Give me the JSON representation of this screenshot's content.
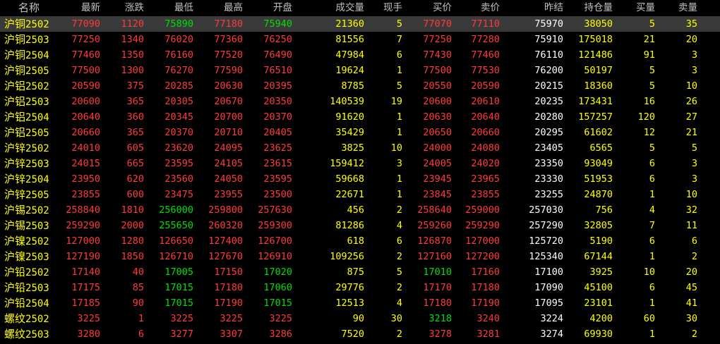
{
  "headers": [
    "名称",
    "最新",
    "涨跌",
    "最低",
    "最高",
    "开盘",
    "成交量",
    "现手",
    "买价",
    "卖价",
    "昨结",
    "持仓量",
    "买量",
    "卖量"
  ],
  "colors": {
    "up": "#ff3b3b",
    "down": "#00e000",
    "volume": "#ffff00",
    "neutral": "#ffffff",
    "name": "#ffff00",
    "header": "#c0c0c0",
    "selected_row_bg": "#3a3a3a"
  },
  "selected_row": 0,
  "rows": [
    {
      "prefix": "沪铜",
      "code": "2502",
      "values": [
        "77090",
        "1120",
        "75890",
        "77180",
        "75940",
        "21360",
        "5",
        "77070",
        "77110",
        "75970",
        "38050",
        "5",
        "35"
      ],
      "colors": [
        "r",
        "r",
        "g",
        "r",
        "g",
        "y",
        "y",
        "r",
        "r",
        "w",
        "y",
        "y",
        "y"
      ]
    },
    {
      "prefix": "沪铜",
      "code": "2503",
      "values": [
        "77250",
        "1340",
        "76020",
        "77360",
        "76250",
        "81556",
        "7",
        "77250",
        "77280",
        "75910",
        "175018",
        "21",
        "20"
      ],
      "colors": [
        "r",
        "r",
        "r",
        "r",
        "r",
        "y",
        "y",
        "r",
        "r",
        "w",
        "y",
        "y",
        "y"
      ]
    },
    {
      "prefix": "沪铜",
      "code": "2504",
      "values": [
        "77460",
        "1350",
        "76160",
        "77520",
        "76490",
        "47984",
        "6",
        "77430",
        "77460",
        "76110",
        "121486",
        "91",
        "3"
      ],
      "colors": [
        "r",
        "r",
        "r",
        "r",
        "r",
        "y",
        "y",
        "r",
        "r",
        "w",
        "y",
        "y",
        "y"
      ]
    },
    {
      "prefix": "沪铜",
      "code": "2505",
      "values": [
        "77500",
        "1300",
        "76270",
        "77590",
        "76510",
        "19624",
        "1",
        "77500",
        "77530",
        "76200",
        "50197",
        "5",
        "3"
      ],
      "colors": [
        "r",
        "r",
        "r",
        "r",
        "r",
        "y",
        "y",
        "r",
        "r",
        "w",
        "y",
        "y",
        "y"
      ]
    },
    {
      "prefix": "沪铝",
      "code": "2502",
      "values": [
        "20590",
        "375",
        "20285",
        "20630",
        "20395",
        "8785",
        "5",
        "20550",
        "20590",
        "20215",
        "18360",
        "5",
        "10"
      ],
      "colors": [
        "r",
        "r",
        "r",
        "r",
        "r",
        "y",
        "y",
        "r",
        "r",
        "w",
        "y",
        "y",
        "y"
      ]
    },
    {
      "prefix": "沪铝",
      "code": "2503",
      "values": [
        "20600",
        "365",
        "20305",
        "20670",
        "20350",
        "140539",
        "19",
        "20600",
        "20610",
        "20235",
        "173431",
        "16",
        "26"
      ],
      "colors": [
        "r",
        "r",
        "r",
        "r",
        "r",
        "y",
        "y",
        "r",
        "r",
        "w",
        "y",
        "y",
        "y"
      ]
    },
    {
      "prefix": "沪铝",
      "code": "2504",
      "values": [
        "20640",
        "360",
        "20345",
        "20700",
        "20370",
        "91620",
        "1",
        "20630",
        "20640",
        "20280",
        "157257",
        "120",
        "27"
      ],
      "colors": [
        "r",
        "r",
        "r",
        "r",
        "r",
        "y",
        "y",
        "r",
        "r",
        "w",
        "y",
        "y",
        "y"
      ]
    },
    {
      "prefix": "沪铝",
      "code": "2505",
      "values": [
        "20660",
        "365",
        "20370",
        "20710",
        "20405",
        "35429",
        "1",
        "20650",
        "20660",
        "20295",
        "61602",
        "12",
        "21"
      ],
      "colors": [
        "r",
        "r",
        "r",
        "r",
        "r",
        "y",
        "y",
        "r",
        "r",
        "w",
        "y",
        "y",
        "y"
      ]
    },
    {
      "prefix": "沪锌",
      "code": "2502",
      "values": [
        "24010",
        "605",
        "23620",
        "24095",
        "23625",
        "3825",
        "10",
        "24000",
        "24080",
        "23405",
        "6565",
        "5",
        "5"
      ],
      "colors": [
        "r",
        "r",
        "r",
        "r",
        "r",
        "y",
        "y",
        "r",
        "r",
        "w",
        "y",
        "y",
        "y"
      ]
    },
    {
      "prefix": "沪锌",
      "code": "2503",
      "values": [
        "24015",
        "665",
        "23595",
        "24105",
        "23615",
        "159412",
        "3",
        "24005",
        "24020",
        "23350",
        "93049",
        "6",
        "3"
      ],
      "colors": [
        "r",
        "r",
        "r",
        "r",
        "r",
        "y",
        "y",
        "r",
        "r",
        "w",
        "y",
        "y",
        "y"
      ]
    },
    {
      "prefix": "沪锌",
      "code": "2504",
      "values": [
        "23950",
        "620",
        "23560",
        "24050",
        "23595",
        "59668",
        "1",
        "23945",
        "23965",
        "23330",
        "51953",
        "6",
        "3"
      ],
      "colors": [
        "r",
        "r",
        "r",
        "r",
        "r",
        "y",
        "y",
        "r",
        "r",
        "w",
        "y",
        "y",
        "y"
      ]
    },
    {
      "prefix": "沪锌",
      "code": "2505",
      "values": [
        "23855",
        "600",
        "23475",
        "23955",
        "23500",
        "22671",
        "1",
        "23845",
        "23855",
        "23255",
        "24870",
        "1",
        "10"
      ],
      "colors": [
        "r",
        "r",
        "r",
        "r",
        "r",
        "y",
        "y",
        "r",
        "r",
        "w",
        "y",
        "y",
        "y"
      ]
    },
    {
      "prefix": "沪锡",
      "code": "2502",
      "values": [
        "258840",
        "1810",
        "256000",
        "259800",
        "257630",
        "456",
        "2",
        "258640",
        "259000",
        "257030",
        "756",
        "4",
        "32"
      ],
      "colors": [
        "r",
        "r",
        "g",
        "r",
        "r",
        "y",
        "y",
        "r",
        "r",
        "w",
        "y",
        "y",
        "y"
      ]
    },
    {
      "prefix": "沪锡",
      "code": "2503",
      "values": [
        "259290",
        "2000",
        "255650",
        "260320",
        "259300",
        "81286",
        "4",
        "259260",
        "259290",
        "257290",
        "32805",
        "7",
        "11"
      ],
      "colors": [
        "r",
        "r",
        "g",
        "r",
        "r",
        "y",
        "y",
        "r",
        "r",
        "w",
        "y",
        "y",
        "y"
      ]
    },
    {
      "prefix": "沪镍",
      "code": "2502",
      "values": [
        "127000",
        "1280",
        "126650",
        "127400",
        "126700",
        "618",
        "6",
        "126870",
        "127000",
        "125720",
        "5190",
        "6",
        "6"
      ],
      "colors": [
        "r",
        "r",
        "r",
        "r",
        "r",
        "y",
        "y",
        "r",
        "r",
        "w",
        "y",
        "y",
        "y"
      ]
    },
    {
      "prefix": "沪镍",
      "code": "2503",
      "values": [
        "127190",
        "1850",
        "126710",
        "127670",
        "126910",
        "109256",
        "2",
        "127160",
        "127200",
        "125340",
        "67144",
        "1",
        "2"
      ],
      "colors": [
        "r",
        "r",
        "r",
        "r",
        "r",
        "y",
        "y",
        "r",
        "r",
        "w",
        "y",
        "y",
        "y"
      ]
    },
    {
      "prefix": "沪铅",
      "code": "2502",
      "values": [
        "17140",
        "40",
        "17005",
        "17150",
        "17020",
        "875",
        "5",
        "17010",
        "17160",
        "17100",
        "3925",
        "10",
        "20"
      ],
      "colors": [
        "r",
        "r",
        "g",
        "r",
        "g",
        "y",
        "y",
        "g",
        "r",
        "w",
        "y",
        "y",
        "y"
      ]
    },
    {
      "prefix": "沪铅",
      "code": "2503",
      "values": [
        "17175",
        "85",
        "17015",
        "17180",
        "17060",
        "29776",
        "2",
        "17170",
        "17180",
        "17090",
        "45100",
        "6",
        "45"
      ],
      "colors": [
        "r",
        "r",
        "g",
        "r",
        "g",
        "y",
        "y",
        "r",
        "r",
        "w",
        "y",
        "y",
        "y"
      ]
    },
    {
      "prefix": "沪铅",
      "code": "2504",
      "values": [
        "17185",
        "90",
        "17015",
        "17190",
        "17015",
        "12513",
        "4",
        "17180",
        "17190",
        "17095",
        "23101",
        "1",
        "41"
      ],
      "colors": [
        "r",
        "r",
        "g",
        "r",
        "g",
        "y",
        "y",
        "r",
        "r",
        "w",
        "y",
        "y",
        "y"
      ]
    },
    {
      "prefix": "螺纹",
      "code": "2502",
      "values": [
        "3225",
        "1",
        "3225",
        "3225",
        "3225",
        "90",
        "30",
        "3218",
        "3240",
        "3224",
        "4200",
        "60",
        "30"
      ],
      "colors": [
        "r",
        "r",
        "r",
        "r",
        "r",
        "y",
        "y",
        "g",
        "r",
        "w",
        "y",
        "y",
        "y"
      ]
    },
    {
      "prefix": "螺纹",
      "code": "2503",
      "values": [
        "3280",
        "6",
        "3277",
        "3307",
        "3286",
        "7520",
        "2",
        "3278",
        "3281",
        "3274",
        "69930",
        "1",
        "2"
      ],
      "colors": [
        "r",
        "r",
        "r",
        "r",
        "r",
        "y",
        "y",
        "r",
        "r",
        "w",
        "y",
        "y",
        "y"
      ]
    }
  ]
}
